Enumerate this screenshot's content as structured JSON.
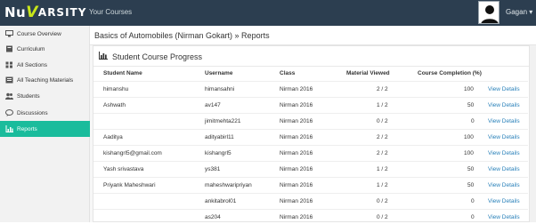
{
  "topbar": {
    "logo_nu": "Nu",
    "logo_v": "V",
    "logo_rest": "ARSITY",
    "nav_courses": "Your Courses",
    "user_name": "Gagan",
    "user_caret": "▾"
  },
  "sidebar": {
    "items": [
      {
        "label": "Course Overview",
        "icon": "desktop-icon"
      },
      {
        "label": "Curriculum",
        "icon": "book-icon"
      },
      {
        "label": "All Sections",
        "icon": "sections-icon"
      },
      {
        "label": "All Teaching Materials",
        "icon": "materials-icon"
      },
      {
        "label": "Students",
        "icon": "users-icon"
      },
      {
        "label": "Discussions",
        "icon": "comments-icon"
      },
      {
        "label": "Reports",
        "icon": "chart-icon",
        "active": true
      }
    ]
  },
  "breadcrumb": "Basics of Automobiles (Nirman Gokart) » Reports",
  "panel": {
    "title": "Student Course Progress"
  },
  "table": {
    "headers": {
      "name": "Student Name",
      "username": "Username",
      "class": "Class",
      "material": "Material Viewed",
      "completion": "Course Completion (%)"
    },
    "rows": [
      {
        "name": "himanshu",
        "username": "himansahni",
        "class": "Nirman 2016",
        "material": "2 / 2",
        "completion": "100",
        "action": "View Details"
      },
      {
        "name": "Ashwath",
        "username": "av147",
        "class": "Nirman 2016",
        "material": "1 / 2",
        "completion": "50",
        "action": "View Details"
      },
      {
        "name": "",
        "username": "jimitmehta221",
        "class": "Nirman 2016",
        "material": "0 / 2",
        "completion": "0",
        "action": "View Details"
      },
      {
        "name": "Aaditya",
        "username": "adityabirl11",
        "class": "Nirman 2016",
        "material": "2 / 2",
        "completion": "100",
        "action": "View Details"
      },
      {
        "name": "kishangrl5@gmail.com",
        "username": "kishangrl5",
        "class": "Nirman 2016",
        "material": "2 / 2",
        "completion": "100",
        "action": "View Details"
      },
      {
        "name": "Yash srivastava",
        "username": "ys381",
        "class": "Nirman 2016",
        "material": "1 / 2",
        "completion": "50",
        "action": "View Details"
      },
      {
        "name": "Priyank Maheshwari",
        "username": "maheshwaripriyan",
        "class": "Nirman 2016",
        "material": "1 / 2",
        "completion": "50",
        "action": "View Details"
      },
      {
        "name": "",
        "username": "ankitabrol01",
        "class": "Nirman 2016",
        "material": "0 / 2",
        "completion": "0",
        "action": "View Details"
      },
      {
        "name": "",
        "username": "as204",
        "class": "Nirman 2016",
        "material": "0 / 2",
        "completion": "0",
        "action": "View Details"
      }
    ]
  }
}
